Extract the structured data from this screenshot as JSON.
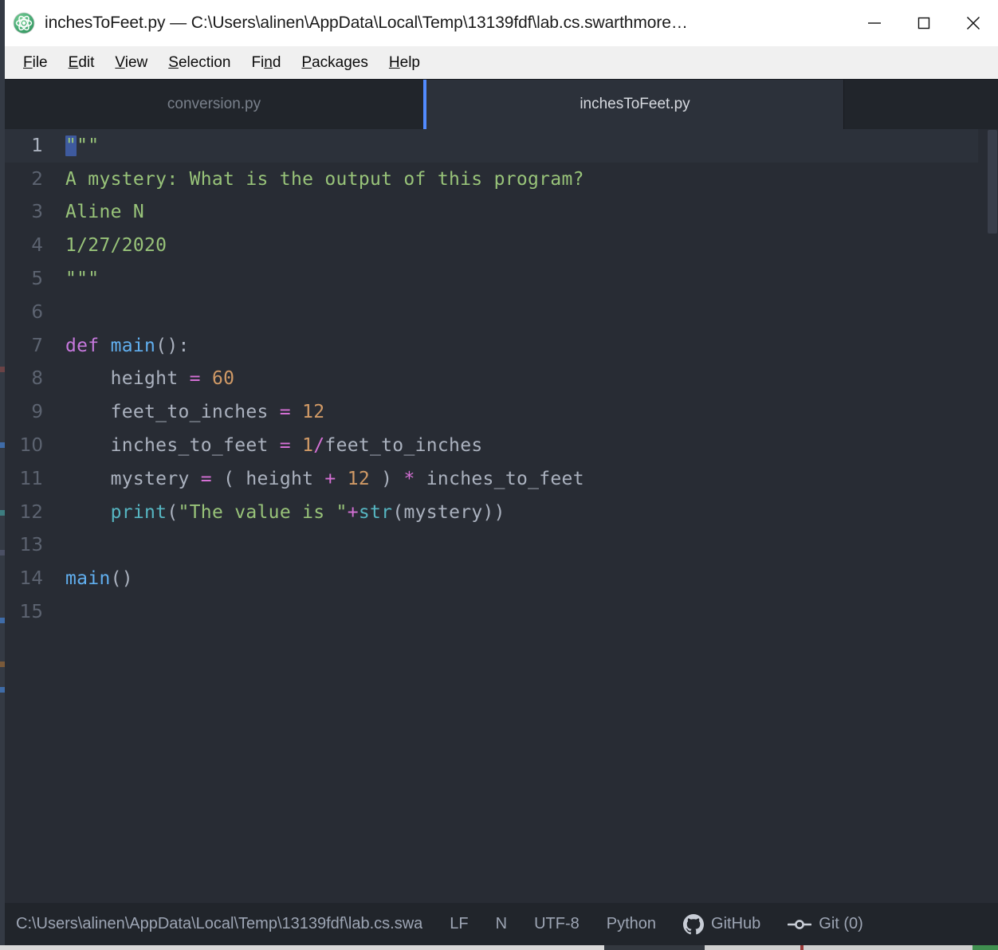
{
  "window": {
    "title": "inchesToFeet.py — C:\\Users\\alinen\\AppData\\Local\\Temp\\13139fdf\\lab.cs.swarthmore…",
    "app_icon": "atom-icon",
    "controls": [
      {
        "name": "minimize",
        "label": "—"
      },
      {
        "name": "maximize",
        "label": "□"
      },
      {
        "name": "close",
        "label": "✕"
      }
    ]
  },
  "menubar": {
    "items": [
      {
        "name": "file",
        "pre": "",
        "mnemonic": "F",
        "post": "ile"
      },
      {
        "name": "edit",
        "pre": "",
        "mnemonic": "E",
        "post": "dit"
      },
      {
        "name": "view",
        "pre": "",
        "mnemonic": "V",
        "post": "iew"
      },
      {
        "name": "selection",
        "pre": "",
        "mnemonic": "S",
        "post": "election"
      },
      {
        "name": "find",
        "pre": "Fi",
        "mnemonic": "n",
        "post": "d"
      },
      {
        "name": "packages",
        "pre": "",
        "mnemonic": "P",
        "post": "ackages"
      },
      {
        "name": "help",
        "pre": "",
        "mnemonic": "H",
        "post": "elp"
      }
    ]
  },
  "tabs": [
    {
      "name": "tab-conversion",
      "label": "conversion.py",
      "active": false
    },
    {
      "name": "tab-inchestofeet",
      "label": "inchesToFeet.py",
      "active": true
    }
  ],
  "editor": {
    "language": "Python",
    "cursor_line": 1,
    "selection": "\"",
    "line_numbers": [
      "1",
      "2",
      "3",
      "4",
      "5",
      "6",
      "7",
      "8",
      "9",
      "10",
      "11",
      "12",
      "13",
      "14",
      "15"
    ],
    "lines": [
      {
        "n": "1",
        "text": "\"\"\""
      },
      {
        "n": "2",
        "text": "A mystery: What is the output of this program?"
      },
      {
        "n": "3",
        "text": "Aline N"
      },
      {
        "n": "4",
        "text": "1/27/2020"
      },
      {
        "n": "5",
        "text": "\"\"\""
      },
      {
        "n": "6",
        "text": ""
      },
      {
        "n": "7",
        "text": "def main():"
      },
      {
        "n": "8",
        "text": "    height = 60"
      },
      {
        "n": "9",
        "text": "    feet_to_inches = 12"
      },
      {
        "n": "10",
        "text": "    inches_to_feet = 1/feet_to_inches"
      },
      {
        "n": "11",
        "text": "    mystery = ( height + 12 ) * inches_to_feet"
      },
      {
        "n": "12",
        "text": "    print(\"The value is \"+str(mystery))"
      },
      {
        "n": "13",
        "text": ""
      },
      {
        "n": "14",
        "text": "main()"
      },
      {
        "n": "15",
        "text": ""
      }
    ]
  },
  "statusbar": {
    "path": "C:\\Users\\alinen\\AppData\\Local\\Temp\\13139fdf\\lab.cs.swa",
    "line_ending": "LF",
    "cursor_indicator": "N",
    "encoding": "UTF-8",
    "grammar": "Python",
    "github_label": "GitHub",
    "git_label": "Git (0)"
  },
  "colors": {
    "editor_bg": "#282c34",
    "gutter_text": "#5c6370",
    "tab_active_bg": "#2c313a",
    "tab_inactive_bg": "#21252b",
    "accent": "#528bff",
    "string": "#98c379",
    "keyword": "#c678dd",
    "function": "#61afef",
    "number": "#d19a66",
    "operator": "#d570d5",
    "builtin": "#56b6c2",
    "selection": "#3e5a9e",
    "status_bg": "#21252b",
    "status_text": "#9da5b4",
    "menubar_bg": "#f0f0f0",
    "titlebar_bg": "#ffffff"
  }
}
